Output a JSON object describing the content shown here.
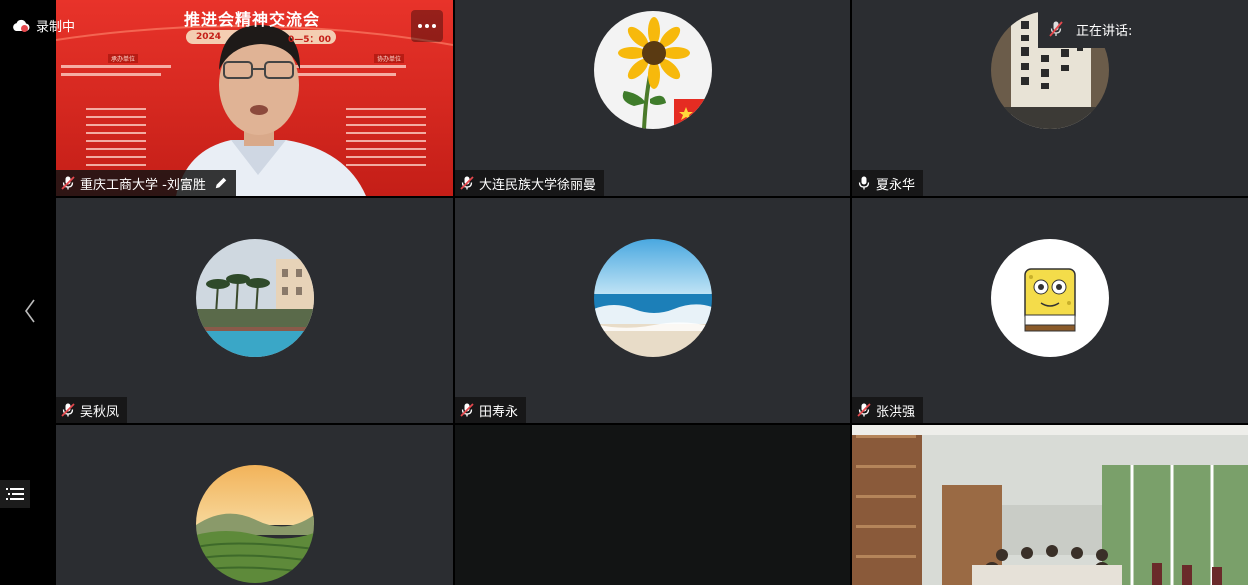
{
  "recording": {
    "label": "录制中"
  },
  "speaking": {
    "label": "正在讲话:"
  },
  "tiles": [
    {
      "name": "重庆工商大学 -刘富胜",
      "mic": "muted",
      "editing": true,
      "kind": "video"
    },
    {
      "name": "大连民族大学徐丽曼",
      "mic": "muted",
      "kind": "avatar",
      "avatar": "sunflower"
    },
    {
      "name": "夏永华",
      "mic": "on",
      "kind": "avatar",
      "avatar": "calligraphy"
    },
    {
      "name": "吴秋凤",
      "mic": "muted",
      "kind": "avatar",
      "avatar": "resort"
    },
    {
      "name": "田寿永",
      "mic": "muted",
      "kind": "avatar",
      "avatar": "ocean"
    },
    {
      "name": "张洪强",
      "mic": "muted",
      "kind": "avatar",
      "avatar": "sponge"
    },
    {
      "name": "",
      "kind": "avatar",
      "avatar": "terraces"
    },
    {
      "name": "",
      "kind": "blank"
    },
    {
      "name": "",
      "kind": "video-room"
    }
  ],
  "banner": {
    "title": "推进会精神交流会",
    "date_partial": "2024",
    "time_partial": "0—5：00",
    "host_label": "承办单位",
    "co_label": "协办单位"
  },
  "colors": {
    "tile_bg": "#2b2d31",
    "muted_red": "#e5484d",
    "banner_red": "#d9261c"
  }
}
